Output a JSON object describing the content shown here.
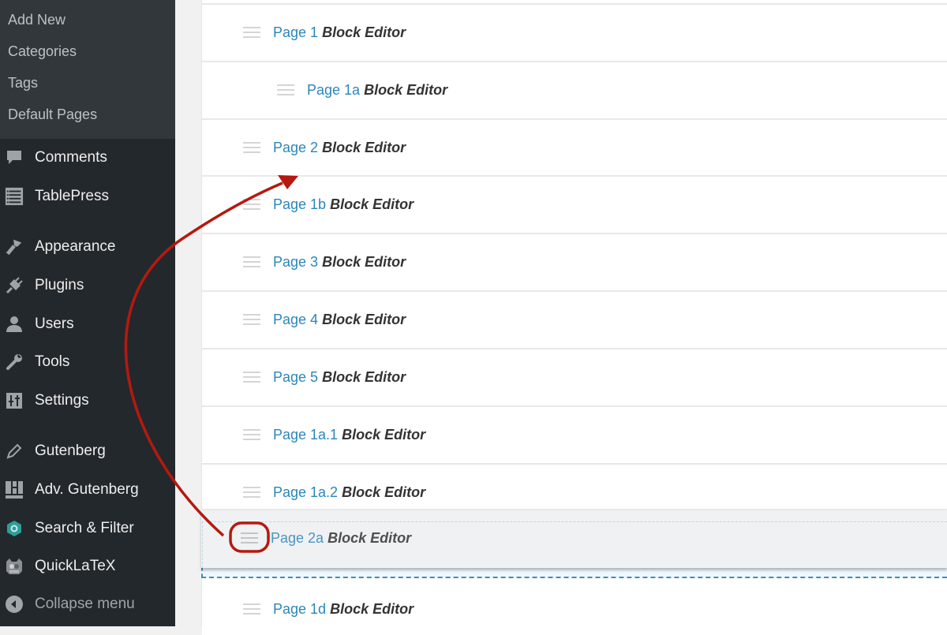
{
  "sidebar": {
    "submenu": [
      {
        "label": "Add New"
      },
      {
        "label": "Categories"
      },
      {
        "label": "Tags"
      },
      {
        "label": "Default Pages"
      }
    ],
    "menu": [
      {
        "label": "Comments",
        "icon": "comment-bubble-icon"
      },
      {
        "label": "TablePress",
        "icon": "table-icon"
      },
      {
        "label": "Appearance",
        "icon": "paintbrush-icon"
      },
      {
        "label": "Plugins",
        "icon": "plug-icon"
      },
      {
        "label": "Users",
        "icon": "user-icon"
      },
      {
        "label": "Tools",
        "icon": "wrench-icon"
      },
      {
        "label": "Settings",
        "icon": "sliders-icon"
      },
      {
        "label": "Gutenberg",
        "icon": "pencil-icon"
      },
      {
        "label": "Adv. Gutenberg",
        "icon": "layout-blocks-icon"
      },
      {
        "label": "Search & Filter",
        "icon": "hexagon-ring-icon"
      },
      {
        "label": "QuickLaTeX",
        "icon": "quicklatex-logo-icon"
      }
    ],
    "collapse_label": "Collapse menu"
  },
  "pages": [
    {
      "name": "Page 1",
      "editor": "Block Editor",
      "depth": 0
    },
    {
      "name": "Page 1a",
      "editor": "Block Editor",
      "depth": 1
    },
    {
      "name": "Page 2",
      "editor": "Block Editor",
      "depth": 0
    },
    {
      "name": "Page 1b",
      "editor": "Block Editor",
      "depth": 0
    },
    {
      "name": "Page 3",
      "editor": "Block Editor",
      "depth": 0
    },
    {
      "name": "Page 4",
      "editor": "Block Editor",
      "depth": 0
    },
    {
      "name": "Page 5",
      "editor": "Block Editor",
      "depth": 0
    },
    {
      "name": "Page 1a.1",
      "editor": "Block Editor",
      "depth": 0
    },
    {
      "name": "Page 1a.2",
      "editor": "Block Editor",
      "depth": 0
    }
  ],
  "dragging": {
    "name": "Page 2a",
    "editor": "Block Editor"
  },
  "after_drop": {
    "name": "Page 1d",
    "editor": "Block Editor",
    "depth": 0
  },
  "colors": {
    "sidebar_bg": "#23282d",
    "submenu_bg": "#32373c",
    "link": "#2a86bb",
    "annotation": "#b5190f",
    "drop_placeholder_border": "#3c8fb5"
  }
}
